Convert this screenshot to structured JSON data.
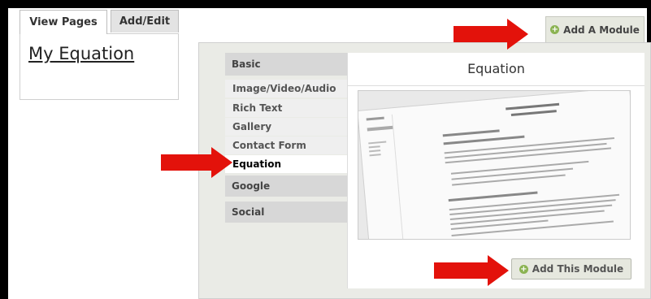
{
  "tabs": [
    {
      "label": "View Pages",
      "active": true
    },
    {
      "label": "Add/Edit",
      "active": false
    }
  ],
  "page_link": "My Equation",
  "add_module_tab": {
    "label": "Add A Module",
    "icon": "plus-circle-icon"
  },
  "categories": {
    "basic": "Basic",
    "basic_items": [
      "Image/Video/Audio",
      "Rich Text",
      "Gallery",
      "Contact Form",
      "Equation"
    ],
    "selected": "Equation",
    "google": "Google",
    "social": "Social"
  },
  "preview": {
    "title": "Equation"
  },
  "add_button": {
    "label": "Add This Module",
    "icon": "plus-circle-icon"
  },
  "colors": {
    "arrow": "#e3120b",
    "plus": "#8bb352"
  }
}
